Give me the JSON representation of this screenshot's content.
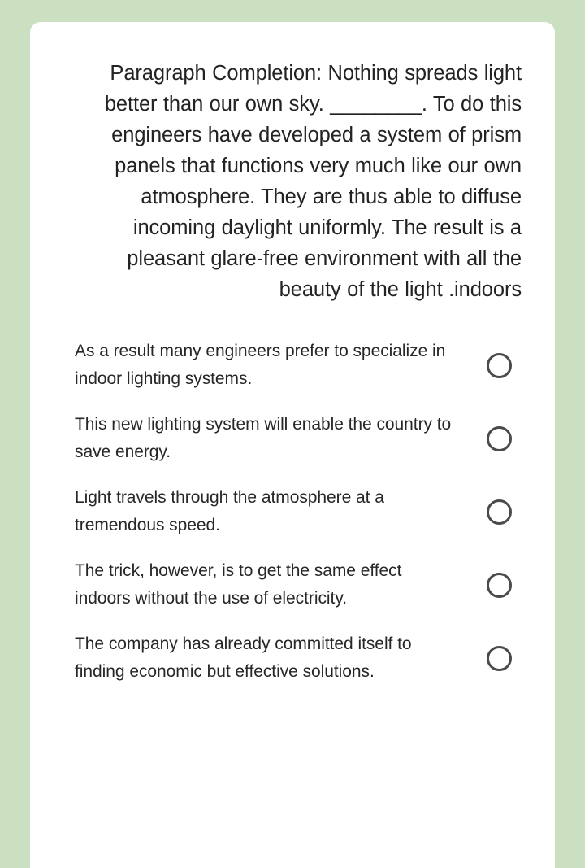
{
  "theme": {
    "page_background": "#cbdfc1",
    "card_background": "#ffffff",
    "text_color": "#232323",
    "radio_border_color": "#4b4b4b"
  },
  "question": {
    "label": "Paragraph Completion:",
    "text": "Paragraph Completion: Nothing spreads light better than our own sky. ________. To do this engineers have developed a system of prism panels that functions very much like our own atmosphere. They are thus able to diffuse incoming daylight uniformly. The result is a pleasant glare-free environment with all the beauty of the light .indoors",
    "blank_placeholder": "________"
  },
  "options": [
    {
      "id": "option-1",
      "label": "As a result many engineers prefer to specialize in indoor lighting systems.",
      "selected": false
    },
    {
      "id": "option-2",
      "label": "This new lighting system will enable the country to save energy.",
      "selected": false
    },
    {
      "id": "option-3",
      "label": "Light travels through the atmosphere at a tremendous speed.",
      "selected": false
    },
    {
      "id": "option-4",
      "label": "The trick, however, is to get the same effect indoors without the use of electricity.",
      "selected": false
    },
    {
      "id": "option-5",
      "label": "The company has already committed itself to finding economic but effective solutions.",
      "selected": false
    }
  ]
}
